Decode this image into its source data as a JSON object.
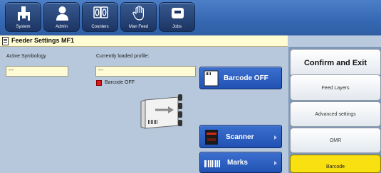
{
  "toolbar": {
    "buttons": [
      {
        "label": "System",
        "icon": "system-icon"
      },
      {
        "label": "Admin",
        "icon": "admin-icon"
      },
      {
        "label": "Counters",
        "icon": "counters-icon"
      },
      {
        "label": "Man Feed",
        "icon": "man-feed-icon"
      },
      {
        "label": "Jobs",
        "icon": "jobs-icon"
      }
    ]
  },
  "header": {
    "title": "Feeder Settings MF1"
  },
  "main": {
    "active_symbology_label": "Active Symbology",
    "active_symbology_value": "---",
    "loaded_profile_label": "Currently loaded profile:",
    "loaded_profile_value": "---",
    "status_text": "Barcode OFF",
    "barcode_button_label": "Barcode OFF",
    "scanner_button_label": "Scanner",
    "marks_button_label": "Marks"
  },
  "sidebar": {
    "confirm_label": "Confirm and Exit",
    "items": [
      {
        "label": "Feed Layers"
      },
      {
        "label": "Advanced settings"
      },
      {
        "label": "OMR"
      },
      {
        "label": "Barcode"
      }
    ]
  },
  "colors": {
    "toolbar": "#3568b2",
    "header_bg": "#fffbd2",
    "field_bg": "#fffbd4",
    "main_bg": "#b7c8dc",
    "feature_button": "#2f62c4",
    "status_red": "#d41c1c",
    "active_yellow": "#f9e010"
  }
}
